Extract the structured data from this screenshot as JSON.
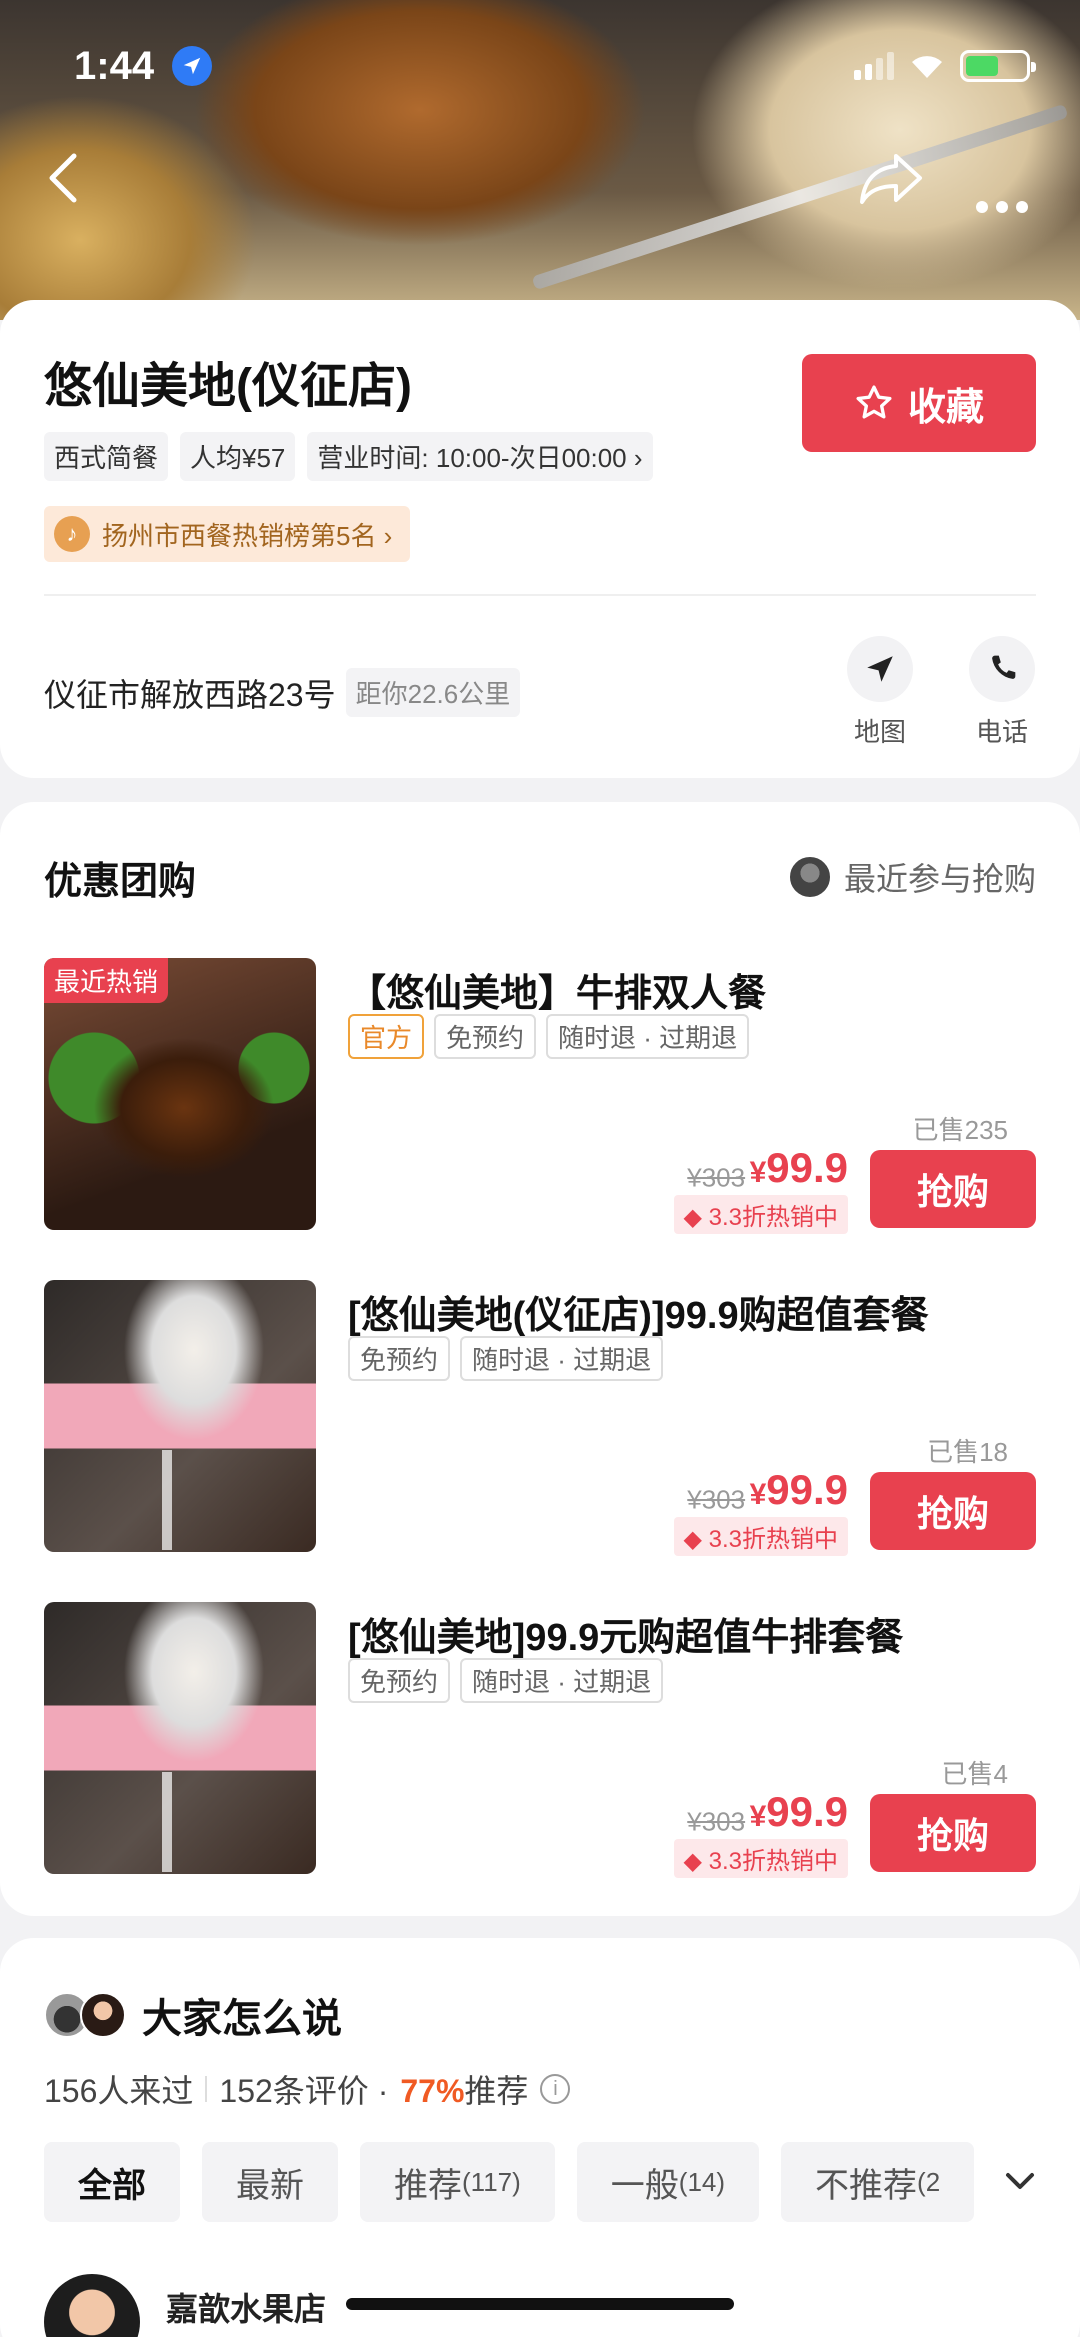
{
  "status": {
    "time": "1:44",
    "location_icon": "location-arrow-icon",
    "signal": "signal-icon",
    "wifi": "wifi-icon",
    "battery": "battery-charging-icon"
  },
  "nav": {
    "back_icon": "back-chevron-icon",
    "share_icon": "share-icon",
    "more_icon": "more-dots-icon"
  },
  "shop": {
    "name": "悠仙美地(仪征店)",
    "tags": [
      "西式简餐",
      "人均¥57",
      "营业时间: 10:00-次日00:00 ›"
    ],
    "rank": "扬州市西餐热销榜第5名 ›",
    "favorite_label": "收藏",
    "address": "仪征市解放西路23号",
    "distance": "距你22.6公里",
    "map_label": "地图",
    "phone_label": "电话"
  },
  "deals_section": {
    "title": "优惠团购",
    "recent_label": "最近参与抢购",
    "items": [
      {
        "badge": "最近热销",
        "title": "【悠仙美地】牛排双人餐",
        "chips": [
          "官方",
          "免预约",
          "随时退 · 过期退"
        ],
        "sold": "已售235",
        "orig_price": "¥303",
        "currency": "¥",
        "price": "99.9",
        "discount": "3.3折热销中",
        "buy_label": "抢购"
      },
      {
        "badge": "",
        "title": "[悠仙美地(仪征店)]99.9购超值套餐",
        "chips": [
          "免预约",
          "随时退 · 过期退"
        ],
        "sold": "已售18",
        "orig_price": "¥303",
        "currency": "¥",
        "price": "99.9",
        "discount": "3.3折热销中",
        "buy_label": "抢购"
      },
      {
        "badge": "",
        "title": "[悠仙美地]99.9元购超值牛排套餐",
        "chips": [
          "免预约",
          "随时退 · 过期退"
        ],
        "sold": "已售4",
        "orig_price": "¥303",
        "currency": "¥",
        "price": "99.9",
        "discount": "3.3折热销中",
        "buy_label": "抢购"
      }
    ]
  },
  "reviews": {
    "title": "大家怎么说",
    "visited": "156人来过",
    "count": "152条评价 ·",
    "pct": "77%",
    "pct_suffix": "推荐",
    "filters": [
      {
        "label": "全部",
        "count": ""
      },
      {
        "label": "最新",
        "count": ""
      },
      {
        "label": "推荐",
        "count": "(117)"
      },
      {
        "label": "一般",
        "count": "(14)"
      },
      {
        "label": "不推荐",
        "count": "(2"
      }
    ],
    "reviewer_name": "嘉歆水果店"
  },
  "colors": {
    "accent": "#e8414f",
    "orange": "#f05a23",
    "rank_bg": "#fde9d9"
  }
}
